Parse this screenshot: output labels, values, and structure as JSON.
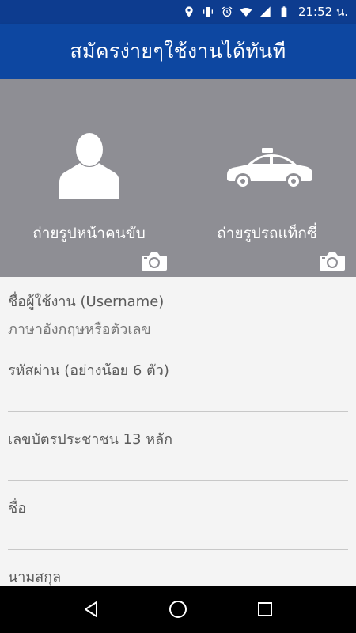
{
  "status_bar": {
    "time": "21:52 น.",
    "icons": [
      "location-icon",
      "vibrate-icon",
      "alarm-icon",
      "wifi-icon",
      "signal-icon",
      "battery-icon"
    ]
  },
  "app_bar": {
    "title": "สมัครง่ายๆใช้งานได้ทันที",
    "color": "#0d47a1"
  },
  "photo_panel": {
    "background": "#8e8e94",
    "driver_photo": {
      "label": "ถ่ายรูปหน้าคนขับ",
      "icon": "person-silhouette-icon"
    },
    "taxi_photo": {
      "label": "ถ่ายรูปรถแท็กซี่",
      "icon": "taxi-car-icon"
    }
  },
  "form": {
    "username": {
      "label": "ชื่อผู้ใช้งาน (Username)",
      "placeholder": "ภาษาอังกฤษหรือตัวเลข"
    },
    "password": {
      "label": "รหัสผ่าน (อย่างน้อย 6 ตัว)"
    },
    "id_card": {
      "label": "เลขบัตรประชาชน 13 หลัก"
    },
    "first_name": {
      "label": "ชื่อ"
    },
    "last_name": {
      "label": "นามสกุล"
    }
  },
  "nav_bar": {
    "icons": [
      "back-icon",
      "home-icon",
      "recents-icon"
    ]
  }
}
